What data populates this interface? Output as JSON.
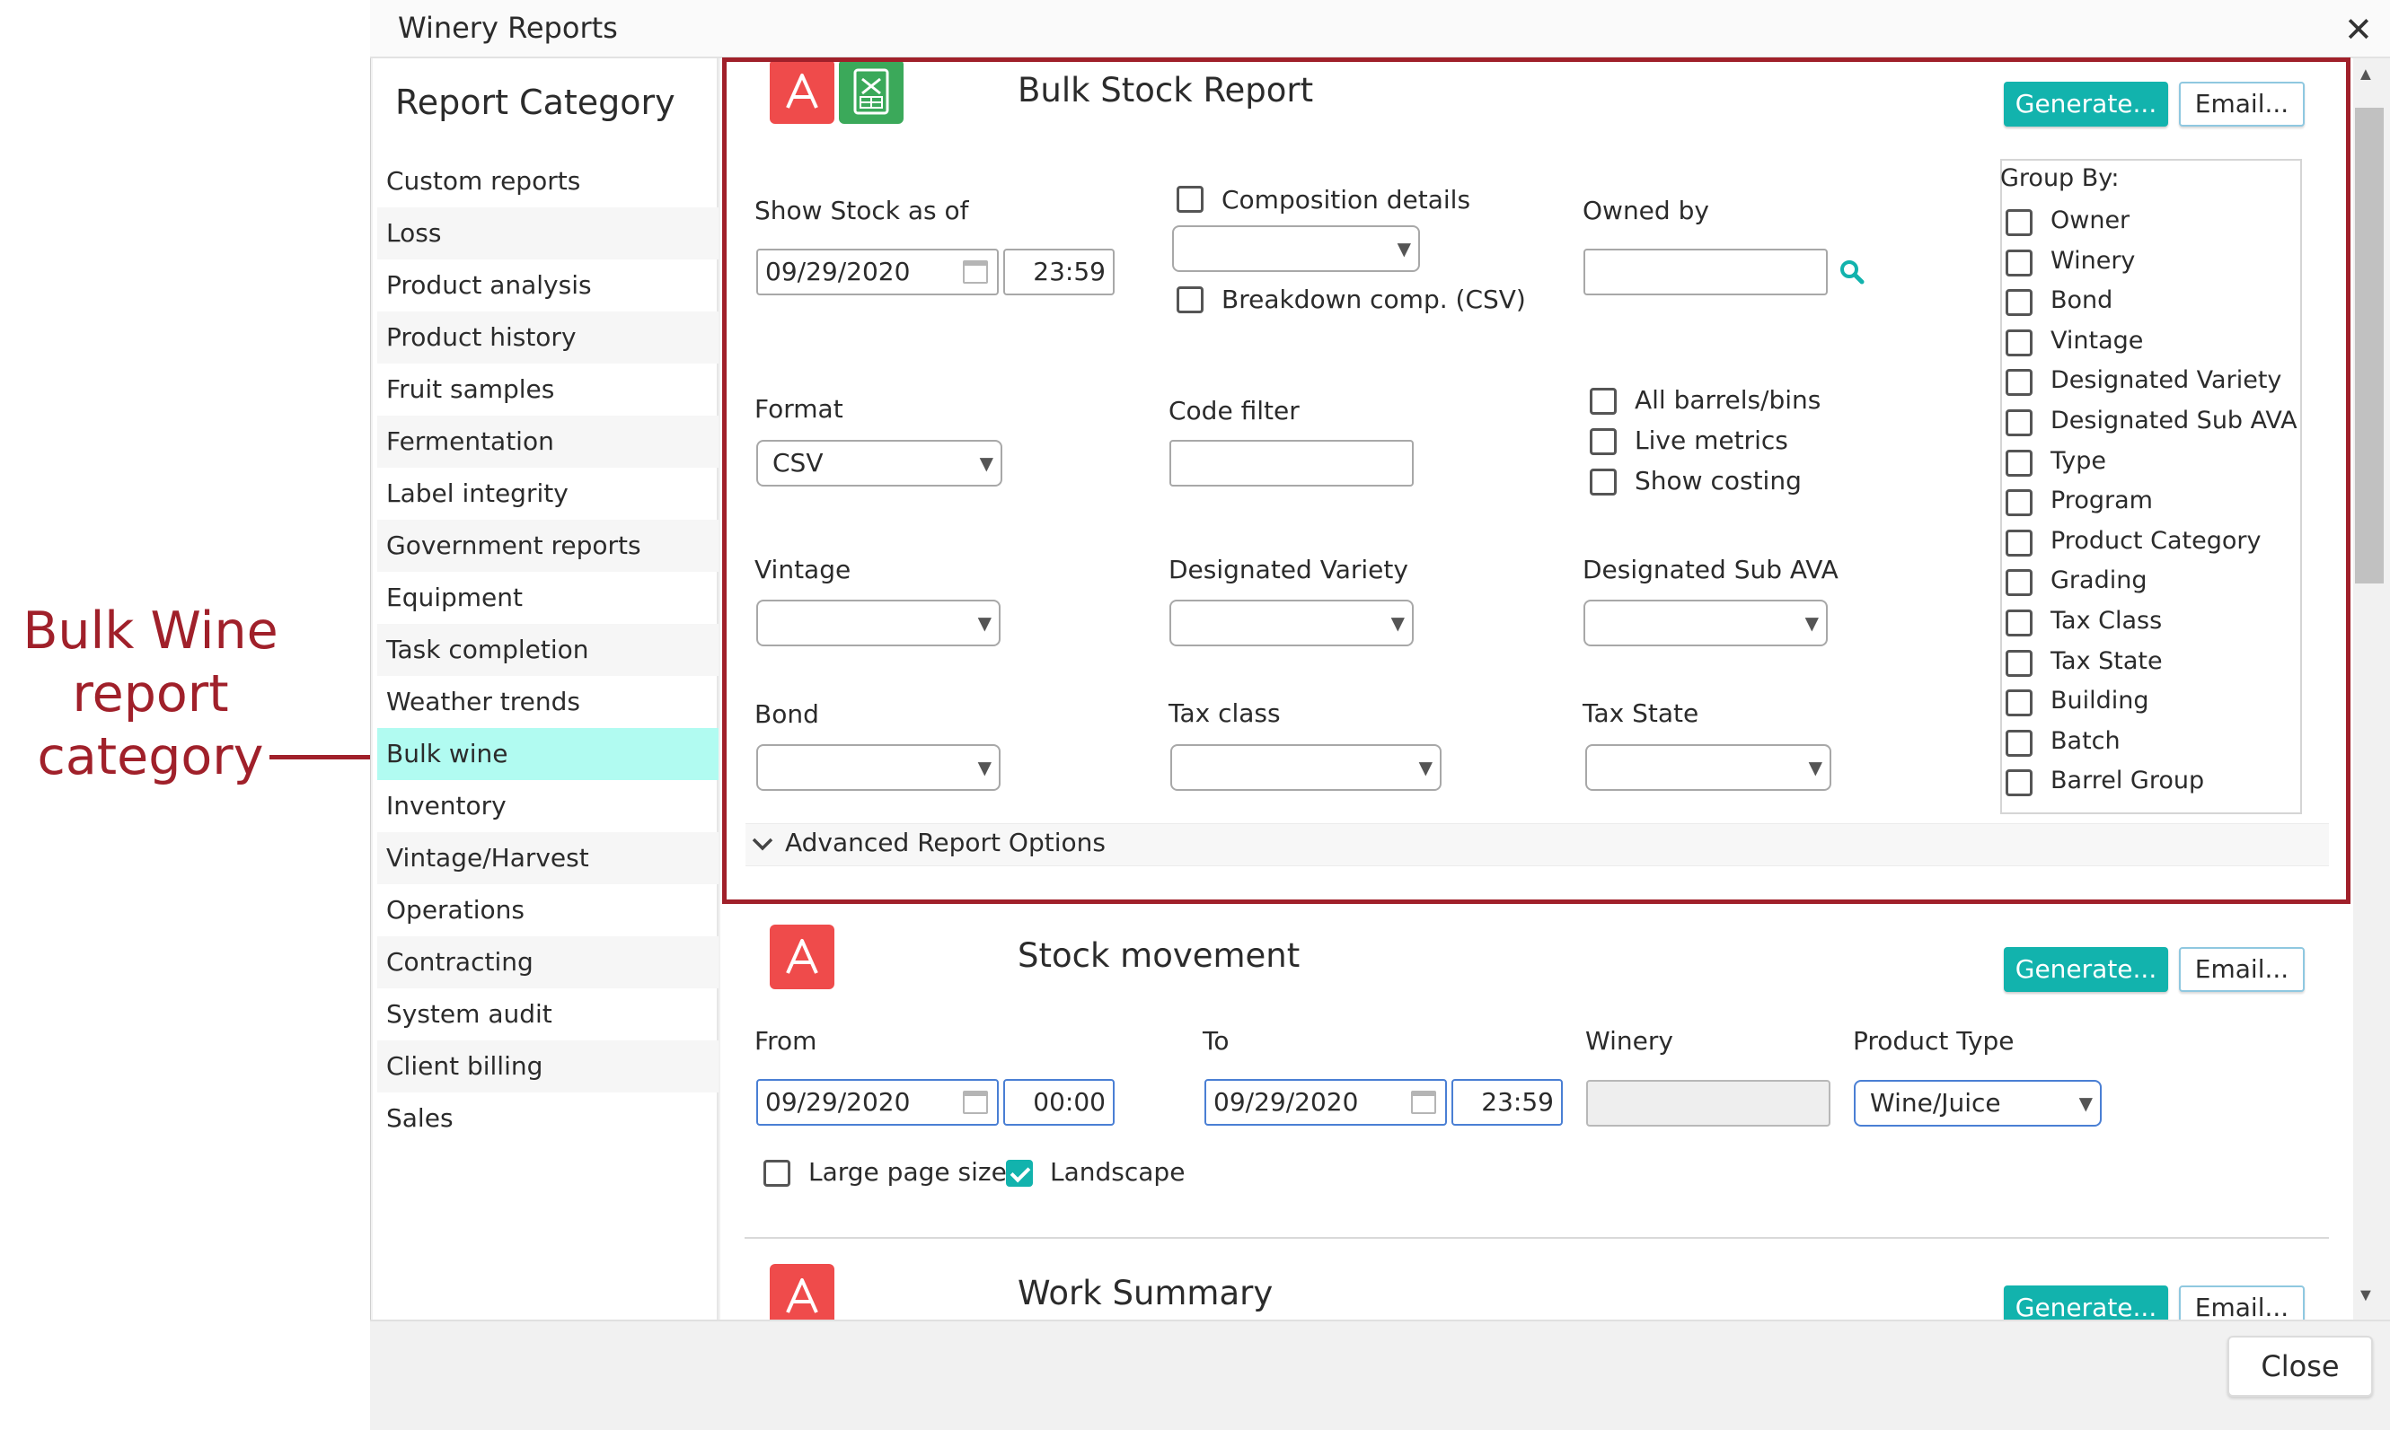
{
  "annotation": {
    "lines": [
      "Bulk Wine",
      "report",
      "category"
    ]
  },
  "dialog": {
    "title": "Winery Reports",
    "close_glyph": "✕",
    "close_button": "Close"
  },
  "sidebar": {
    "heading": "Report Category",
    "items": [
      {
        "label": "Custom reports"
      },
      {
        "label": "Loss"
      },
      {
        "label": "Product analysis"
      },
      {
        "label": "Product history"
      },
      {
        "label": "Fruit samples"
      },
      {
        "label": "Fermentation"
      },
      {
        "label": "Label integrity"
      },
      {
        "label": "Government reports"
      },
      {
        "label": "Equipment"
      },
      {
        "label": "Task completion"
      },
      {
        "label": "Weather trends"
      },
      {
        "label": "Bulk wine",
        "active": true
      },
      {
        "label": "Inventory"
      },
      {
        "label": "Vintage/Harvest"
      },
      {
        "label": "Operations"
      },
      {
        "label": "Contracting"
      },
      {
        "label": "System audit"
      },
      {
        "label": "Client billing"
      },
      {
        "label": "Sales"
      }
    ]
  },
  "bulk_stock": {
    "title": "Bulk Stock Report",
    "generate": "Generate...",
    "email": "Email...",
    "show_stock_label": "Show Stock as of",
    "date": "09/29/2020",
    "time": "23:59",
    "composition_details": "Composition details",
    "composition_select": "",
    "breakdown_comp": "Breakdown comp. (CSV)",
    "owned_by_label": "Owned by",
    "owned_by_value": "",
    "format_label": "Format",
    "format_value": "CSV",
    "code_filter_label": "Code filter",
    "code_filter_value": "",
    "all_barrels": "All barrels/bins",
    "live_metrics": "Live metrics",
    "show_costing": "Show costing",
    "vintage_label": "Vintage",
    "designated_variety_label": "Designated Variety",
    "designated_sub_ava_label": "Designated Sub AVA",
    "bond_label": "Bond",
    "tax_class_label": "Tax class",
    "tax_state_label": "Tax State",
    "group_by_label": "Group By:",
    "group_by_options": [
      "Owner",
      "Winery",
      "Bond",
      "Vintage",
      "Designated Variety",
      "Designated Sub AVA",
      "Type",
      "Program",
      "Product Category",
      "Grading",
      "Tax Class",
      "Tax State",
      "Building",
      "Batch",
      "Barrel Group"
    ],
    "advanced_options": "Advanced Report Options",
    "chevron": "⌄"
  },
  "stock_movement": {
    "title": "Stock movement",
    "generate": "Generate...",
    "email": "Email...",
    "from_label": "From",
    "from_date": "09/29/2020",
    "from_time": "00:00",
    "to_label": "To",
    "to_date": "09/29/2020",
    "to_time": "23:59",
    "winery_label": "Winery",
    "winery_value": "",
    "product_type_label": "Product Type",
    "product_type_value": "Wine/Juice",
    "large_page_size": "Large page size",
    "landscape": "Landscape"
  },
  "work_summary": {
    "title": "Work Summary",
    "generate": "Generate...",
    "email": "Email..."
  },
  "glyphs": {
    "dropdown_arrow": "▼",
    "scroll_up": "▲",
    "scroll_down": "▼",
    "search_icon": "search-icon"
  },
  "colors": {
    "accent": "#12b3ad",
    "highlight": "#a0202a",
    "active_item": "#b1fbf1",
    "pdf": "#ef4b4b",
    "excel": "#3ba95a"
  }
}
